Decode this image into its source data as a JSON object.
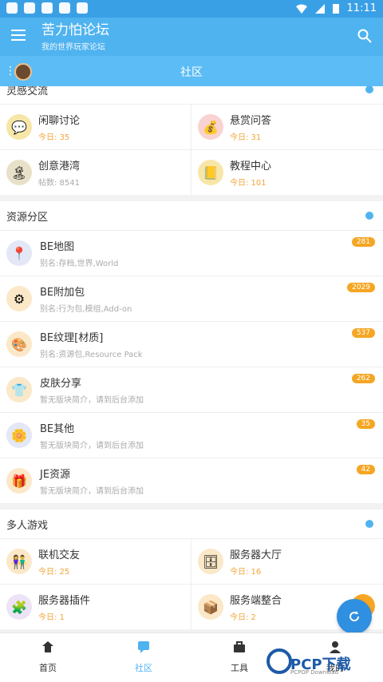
{
  "statusbar": {
    "time": "11:11"
  },
  "appbar": {
    "title": "苦力怕论坛",
    "subtitle": "我的世界玩家论坛"
  },
  "subbar": {
    "title": "社区"
  },
  "sections": [
    {
      "title": "灵感交流",
      "items": [
        {
          "name": "闲聊讨论",
          "stat": "今日: 35",
          "icon": "chat-bubble-icon",
          "color": "#f6e6a8"
        },
        {
          "name": "悬赏问答",
          "stat": "今日: 31",
          "icon": "coins-icon",
          "color": "#f9d3d3"
        },
        {
          "name": "创意港湾",
          "stat": "帖数: 8541",
          "icon": "island-icon",
          "color": "#e8e0c8",
          "muted": true
        },
        {
          "name": "教程中心",
          "stat": "今日: 101",
          "icon": "notebook-icon",
          "color": "#f8e6a8"
        }
      ]
    },
    {
      "title": "资源分区",
      "items": [
        {
          "name": "BE地图",
          "desc": "别名:存档,世界,World",
          "badge": "281",
          "icon": "map-pin-icon",
          "color": "#e3e7f6"
        },
        {
          "name": "BE附加包",
          "desc": "别名:行为包,模组,Add-on",
          "badge": "2029",
          "icon": "gear-icon",
          "color": "#fbe8c8"
        },
        {
          "name": "BE纹理[材质]",
          "desc": "别名:资源包,Resource Pack",
          "badge": "537",
          "icon": "texture-icon",
          "color": "#fbe8c8"
        },
        {
          "name": "皮肤分享",
          "desc": "暂无版块简介，请到后台添加",
          "badge": "262",
          "icon": "shirt-icon",
          "color": "#fbe8c8"
        },
        {
          "name": "BE其他",
          "desc": "暂无版块简介，请到后台添加",
          "badge": "35",
          "icon": "flower-icon",
          "color": "#e3e7f6"
        },
        {
          "name": "JE资源",
          "desc": "暂无版块简介，请到后台添加",
          "badge": "42",
          "icon": "gift-icon",
          "color": "#fbe8c8"
        }
      ]
    },
    {
      "title": "多人游戏",
      "items": [
        {
          "name": "联机交友",
          "stat": "今日: 25",
          "icon": "friends-icon",
          "color": "#fbe8c8"
        },
        {
          "name": "服务器大厅",
          "stat": "今日: 16",
          "icon": "server-icon",
          "color": "#fbe8c8"
        },
        {
          "name": "服务器插件",
          "stat": "今日: 1",
          "icon": "plugin-icon",
          "color": "#ece3f6"
        },
        {
          "name": "服务端整合",
          "stat": "今日: 2",
          "icon": "package-icon",
          "color": "#fbe8c8"
        }
      ]
    }
  ],
  "nav": [
    {
      "label": "首页",
      "icon": "home-icon"
    },
    {
      "label": "社区",
      "icon": "community-icon",
      "active": true
    },
    {
      "label": "工具",
      "icon": "toolbox-icon"
    },
    {
      "label": "我的",
      "icon": "profile-icon"
    }
  ],
  "watermark": {
    "text": "PCP下载",
    "sub": "PCPOP Download"
  }
}
